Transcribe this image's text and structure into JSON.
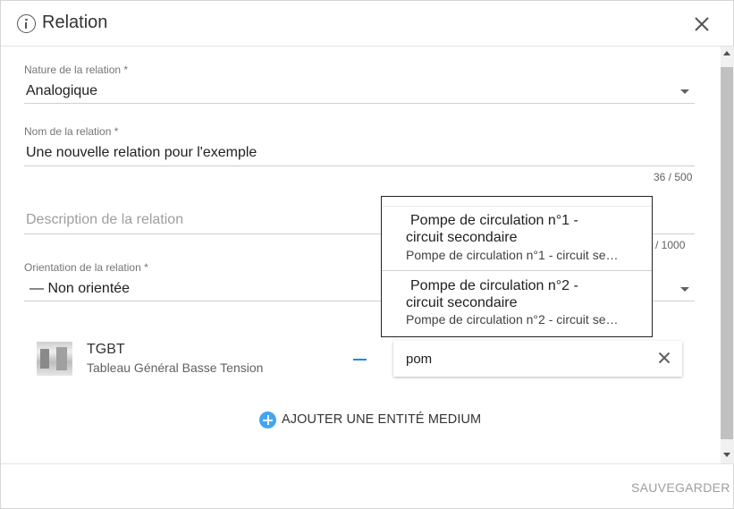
{
  "dialog": {
    "title": "Relation",
    "save_label": "SAUVEGARDER"
  },
  "nature": {
    "label": "Nature de la relation *",
    "value": "Analogique"
  },
  "name": {
    "label": "Nom de la relation *",
    "value": "Une nouvelle relation pour l'exemple",
    "counter": "36 / 500"
  },
  "description": {
    "placeholder": "Description de la relation",
    "counter": "0 / 1000"
  },
  "orientation": {
    "label": "Orientation de la relation *",
    "value": "— Non orientée"
  },
  "entity": {
    "name": "TGBT",
    "description": "Tableau Général Basse Tension"
  },
  "search": {
    "value": "pom"
  },
  "add_entity_label": "AJOUTER UNE ENTITÉ MEDIUM",
  "suggestions": [
    {
      "title_line1": "Pompe de circulation n°1 -",
      "title_line2": "circuit secondaire",
      "subtitle": "Pompe de circulation n°1 - circuit se…"
    },
    {
      "title_line1": "Pompe de circulation n°2 -",
      "title_line2": "circuit secondaire",
      "subtitle": "Pompe de circulation n°2 - circuit se…"
    }
  ],
  "colors": {
    "accent": "#42a5f5",
    "link": "#1e88e5",
    "text": "#212121",
    "muted": "#757575"
  }
}
